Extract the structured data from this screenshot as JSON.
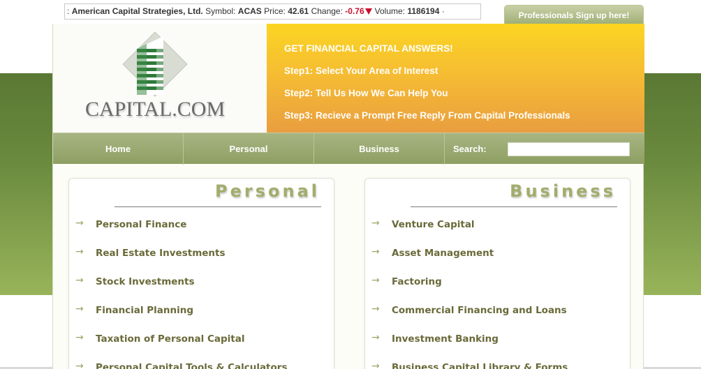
{
  "ticker": {
    "prefix": ":",
    "company": "American Capital Strategies, Ltd.",
    "symbol_label": "Symbol:",
    "symbol": "ACAS",
    "price_label": "Price:",
    "price": "42.61",
    "change_label": "Change:",
    "change": "-0.76",
    "volume_label": "Volume:",
    "volume": "1186194",
    "suffix": "·"
  },
  "header": {
    "pro_signup": "Professionals Sign up here!",
    "logo_text": "CAPITAL.COM"
  },
  "cta": {
    "lines": [
      "GET FINANCIAL CAPITAL ANSWERS!",
      "Step1: Select Your Area of Interest",
      "Step2: Tell Us How We Can Help You",
      "Step3: Recieve a Prompt Free Reply From Capital Professionals"
    ]
  },
  "nav": {
    "items": [
      "Home",
      "Personal",
      "Business"
    ],
    "search_label": "Search:",
    "search_value": ""
  },
  "personal": {
    "title": "Personal",
    "items": [
      "Personal Finance",
      "Real Estate Investments",
      "Stock Investments",
      "Financial Planning",
      "Taxation of Personal Capital",
      "Personal Capital Tools & Calculators"
    ]
  },
  "business": {
    "title": "Business",
    "items": [
      "Venture Capital",
      "Asset Management",
      "Factoring",
      "Commercial Financing and Loans",
      "Investment Banking",
      "Business Capital Library & Forms"
    ]
  },
  "icons": {
    "list_arrow": "→",
    "down_arrow": "down-arrow-icon",
    "logo": "building-logo-icon"
  },
  "colors": {
    "accent_green": "#8e9f62",
    "cta_orange": "#e99e40",
    "cta_yellow": "#fbd522",
    "negative": "#c8102e"
  }
}
